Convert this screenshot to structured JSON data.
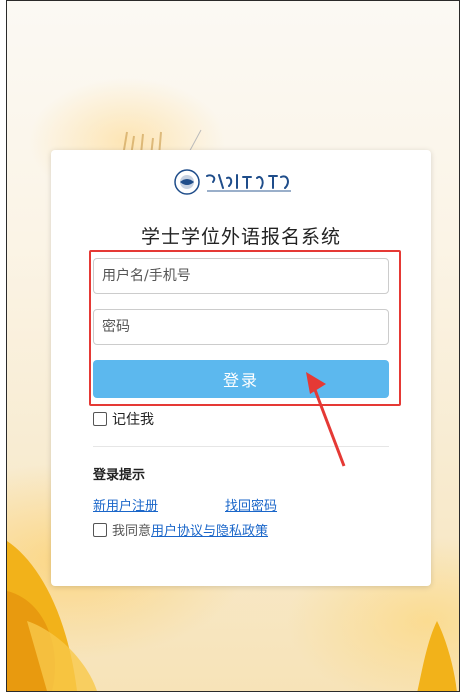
{
  "page": {
    "system_title": "学士学位外语报名系统",
    "logo_alt": "武汉轻工大学"
  },
  "login_form": {
    "username_placeholder": "用户名/手机号",
    "password_placeholder": "密码",
    "login_button": "登录",
    "remember_label": "记住我"
  },
  "hints": {
    "title": "登录提示",
    "register_link": "新用户注册",
    "recover_link": "找回密码",
    "agree_prefix": "我同意",
    "agree_link": "用户协议与隐私政策"
  },
  "colors": {
    "primary_button": "#5cb8ee",
    "link": "#1a66c9",
    "highlight_box": "#e53935",
    "arrow": "#e53935"
  }
}
